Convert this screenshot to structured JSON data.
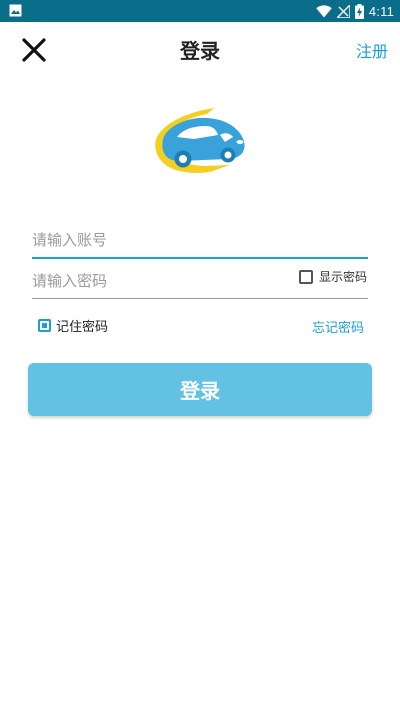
{
  "status_bar": {
    "time": "4:11",
    "icons": [
      "image-notification-icon",
      "wifi-icon",
      "signal-icon",
      "battery-charging-icon"
    ]
  },
  "header": {
    "close_icon": "close-icon",
    "title": "登录",
    "register_label": "注册"
  },
  "logo": {
    "icon": "car-logo-icon"
  },
  "form": {
    "account_placeholder": "请输入账号",
    "account_value": "",
    "password_placeholder": "请输入密码",
    "password_value": "",
    "show_password_label": "显示密码",
    "show_password_checked": false,
    "remember_label": "记住密码",
    "remember_checked": true,
    "forgot_label": "忘记密码",
    "login_label": "登录"
  },
  "colors": {
    "status_bar": "#0a6e8a",
    "accent": "#1aa0d8",
    "login_button": "#63c1e4"
  }
}
